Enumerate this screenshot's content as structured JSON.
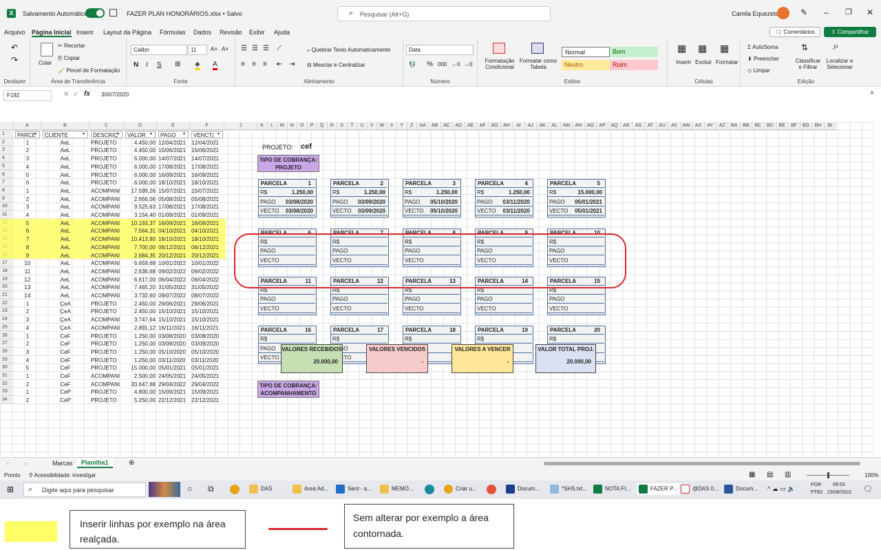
{
  "titlebar": {
    "autosave_label": "Salvamento Automático",
    "autosave_state": "on",
    "doc_title": "FAZER PLAN HONORÁRIOS.xlsx • Salvo",
    "search_placeholder": "Pesquisar (Alt+G)",
    "user": "Camila Equezeto"
  },
  "menu": {
    "items": [
      "Arquivo",
      "Página Inicial",
      "Inserir",
      "Layout da Página",
      "Fórmulas",
      "Dados",
      "Revisão",
      "Exibir",
      "Ajuda"
    ],
    "comments": "Comentários",
    "share": "Compartilhar"
  },
  "ribbon": {
    "clip": {
      "paste": "Colar",
      "cut": "Recortar",
      "copy": "Copiar",
      "format_painter": "Pincel de Formatação",
      "label": "Área de Transferência",
      "undo": "Desfazer"
    },
    "font": {
      "name": "Calibri",
      "size": "11",
      "label": "Fonte"
    },
    "align": {
      "wrap": "Quebrar Texto Automaticamente",
      "merge": "Mesclar e Centralizar",
      "label": "Alinhamento"
    },
    "number": {
      "format": "Data",
      "label": "Número"
    },
    "styles": {
      "cond": "Formatação Condicional",
      "table": "Formatar como Tabela",
      "normal": "Normal",
      "bom": "Bom",
      "neutro": "Neutro",
      "ruim": "Ruim",
      "label": "Estilos"
    },
    "cells": {
      "insert": "Inserir",
      "delete": "Excluir",
      "format": "Formatar",
      "label": "Células"
    },
    "edit": {
      "autosum": "AutoSoma",
      "fill": "Preencher",
      "clear": "Limpar",
      "sort": "Classificar e Filtrar",
      "find": "Localizar e Selecionar",
      "label": "Edição"
    }
  },
  "formula": {
    "namebox": "F192",
    "value": "30/07/2020"
  },
  "columns": [
    "A",
    "B",
    "C",
    "D",
    "E",
    "F",
    "J",
    "K",
    "L",
    "M",
    "N",
    "O",
    "P",
    "Q",
    "R",
    "S",
    "T",
    "U",
    "V",
    "W",
    "X",
    "Y",
    "Z",
    "AA",
    "AB",
    "AC",
    "AD",
    "AE",
    "AF",
    "AG",
    "AH",
    "AI",
    "AJ",
    "AK",
    "AL",
    "AM",
    "AN",
    "AO",
    "AP",
    "AQ",
    "AR",
    "AS",
    "AT",
    "AU",
    "AV",
    "AW",
    "AX",
    "AY",
    "AZ",
    "BA",
    "BB",
    "BC",
    "BD",
    "BE",
    "BF",
    "BG",
    "BH",
    "BI"
  ],
  "headers": [
    "PARCE",
    "CLIENTE",
    "DESCRIÇ",
    "VALOR",
    "PAGO",
    "VENCT("
  ],
  "rows": [
    [
      "1",
      "AeL",
      "PROJETO",
      "4.450,00",
      "12/04/2021",
      "12/04/2021"
    ],
    [
      "2",
      "AeL",
      "PROJETO",
      "4.450,00",
      "15/06/2021",
      "15/06/2021"
    ],
    [
      "3",
      "AeL",
      "PROJETO",
      "6.000,00",
      "14/07/2021",
      "14/07/2021"
    ],
    [
      "4",
      "AeL",
      "PROJETO",
      "6.000,00",
      "17/08/2021",
      "17/08/2021"
    ],
    [
      "5",
      "AeL",
      "PROJETO",
      "6.000,00",
      "16/09/2021",
      "16/09/2021"
    ],
    [
      "6",
      "AeL",
      "PROJETO",
      "6.000,00",
      "18/10/2021",
      "18/10/2021"
    ],
    [
      "1",
      "AeL",
      "ACOMPANI",
      "17.599,26",
      "15/07/2021",
      "15/07/2021"
    ],
    [
      "2",
      "AeL",
      "ACOMPANI",
      "2.656,06",
      "05/08/2021",
      "05/08/2021"
    ],
    [
      "3",
      "AeL",
      "ACOMPANI",
      "9.525,63",
      "17/08/2021",
      "17/08/2021"
    ],
    [
      "4",
      "AeL",
      "ACOMPANI",
      "3.154,40",
      "01/09/2021",
      "01/09/2021"
    ],
    [
      "5",
      "AeL",
      "ACOMPANI",
      "10.193,37",
      "16/09/2021",
      "16/09/2021"
    ],
    [
      "6",
      "AeL",
      "ACOMPANI",
      "7.564,31",
      "04/10/2021",
      "04/10/2021"
    ],
    [
      "7",
      "AeL",
      "ACOMPANI",
      "10.413,90",
      "18/10/2021",
      "18/10/2021"
    ],
    [
      "8",
      "AeL",
      "ACOMPANI",
      "7.700,00",
      "06/12/2021",
      "06/12/2021"
    ],
    [
      "9",
      "AeL",
      "ACOMPANI",
      "2.684,35",
      "20/12/2021",
      "20/12/2021"
    ],
    [
      "10",
      "AeL",
      "ACOMPANI",
      "6.659,68",
      "10/01/2022",
      "10/01/2022"
    ],
    [
      "11",
      "AeL",
      "ACOMPANI",
      "2.636,68",
      "09/02/2022",
      "09/02/2022"
    ],
    [
      "12",
      "AeL",
      "ACOMPANI",
      "6.617,00",
      "06/04/2022",
      "06/04/2022"
    ],
    [
      "13",
      "AeL",
      "ACOMPANI",
      "7.465,20",
      "31/05/2022",
      "31/05/2022"
    ],
    [
      "14",
      "AeL",
      "ACOMPANI",
      "3.732,60",
      "08/07/2022",
      "08/07/2022"
    ],
    [
      "1",
      "ÇeA",
      "PROJETO",
      "2.450,00",
      "29/06/2021",
      "29/06/2021"
    ],
    [
      "2",
      "ÇeA",
      "PROJETO",
      "2.450,00",
      "15/10/2021",
      "15/10/2021"
    ],
    [
      "3",
      "ÇeA",
      "ACOMPANI",
      "3.747,64",
      "15/10/2021",
      "15/10/2021"
    ],
    [
      "4",
      "ÇeA",
      "ACOMPANI",
      "2.891,12",
      "16/11/2021",
      "16/11/2021"
    ],
    [
      "1",
      "CeF",
      "PROJETO",
      "1.250,00",
      "03/08/2020",
      "03/08/2020"
    ],
    [
      "2",
      "CeF",
      "PROJETO",
      "1.250,00",
      "03/09/2020",
      "03/09/2020"
    ],
    [
      "3",
      "CeF",
      "PROJETO",
      "1.250,00",
      "05/10/2020",
      "05/10/2020"
    ],
    [
      "4",
      "CeF",
      "PROJETO",
      "1.250,00",
      "03/11/2020",
      "03/11/2020"
    ],
    [
      "5",
      "CeF",
      "PROJETO",
      "15.000,00",
      "05/01/2021",
      "05/01/2021"
    ],
    [
      "1",
      "CeF",
      "ACOMPANI",
      "2.500,00",
      "24/05/2021",
      "24/05/2021"
    ],
    [
      "2",
      "CeF",
      "ACOMPANI",
      "33.647,68",
      "29/04/2022",
      "29/04/2022"
    ],
    [
      "1",
      "CeP",
      "PROJETO",
      "4.800,00",
      "15/09/2021",
      "15/09/2021"
    ],
    [
      "2",
      "CeP",
      "PROJETO",
      "5.250,00",
      "22/12/2021",
      "22/12/2021"
    ]
  ],
  "panel": {
    "projeto_label": "PROJETO:",
    "projeto_value": "cef",
    "tipo1": "TIPO DE COBRANÇA: PROJETO",
    "tipo2": "TIPO DE COBRANÇA: ACOMPANHAMENTO",
    "parcel_word": "PARCELA",
    "rs": "R$",
    "pago": "PAGO",
    "vecto": "VECTO",
    "parcels": [
      {
        "n": "1",
        "rs": "1.250,00",
        "pago": "03/08/2020",
        "vecto": "03/08/2020"
      },
      {
        "n": "2",
        "rs": "1.250,00",
        "pago": "03/09/2020",
        "vecto": "03/09/2020"
      },
      {
        "n": "3",
        "rs": "1.250,00",
        "pago": "05/10/2020",
        "vecto": "05/10/2020"
      },
      {
        "n": "4",
        "rs": "1.250,00",
        "pago": "03/11/2020",
        "vecto": "03/11/2020"
      },
      {
        "n": "5",
        "rs": "15.000,00",
        "pago": "05/01/2021",
        "vecto": "05/01/2021"
      },
      {
        "n": "6"
      },
      {
        "n": "7"
      },
      {
        "n": "8"
      },
      {
        "n": "9"
      },
      {
        "n": "10"
      },
      {
        "n": "11"
      },
      {
        "n": "12"
      },
      {
        "n": "13"
      },
      {
        "n": "14"
      },
      {
        "n": "15"
      },
      {
        "n": "16"
      },
      {
        "n": "17"
      },
      {
        "n": "18"
      },
      {
        "n": "19"
      },
      {
        "n": "20"
      }
    ],
    "summary": [
      {
        "label": "VALORES RECEBIDOS",
        "value": "20.000,00",
        "color": "#c6e0b4"
      },
      {
        "label": "VALORES VENCIDOS",
        "value": "-",
        "color": "#f8cbcb"
      },
      {
        "label": "VALORES A VENCER",
        "value": "-",
        "color": "#ffe699"
      },
      {
        "label": "VALOR TOTAL PROJ.",
        "value": "20.000,00",
        "color": "#d9e1f2"
      }
    ]
  },
  "sheets": [
    "Marcas",
    "Planilha1"
  ],
  "status": {
    "ready": "Pronto",
    "access": "Acessibilidade: investigar",
    "zoom": "100%"
  },
  "taskbar": {
    "search": "Digite aqui para pesquisar",
    "apps": [
      "DAS",
      "Area Ad...",
      "Sent - a...",
      "MEMÓ...",
      "Criar u...",
      "Docum...",
      "*SHS.txt...",
      "NOTA FI...",
      "FAZER P...",
      "@DAS 0...",
      "Docum..."
    ],
    "lang": "POR",
    "layout": "PTB2",
    "time": "09:53",
    "date": "23/08/2022"
  },
  "legend": {
    "yellow": "Inserir linhas por exemplo na área realçada.",
    "red": "Sem alterar por exemplo a área contornada."
  },
  "colors": {
    "excel_green": "#107c41",
    "highlight": "#ffff66",
    "outline": "#d9252a",
    "tipo": "#c9a6e6"
  }
}
